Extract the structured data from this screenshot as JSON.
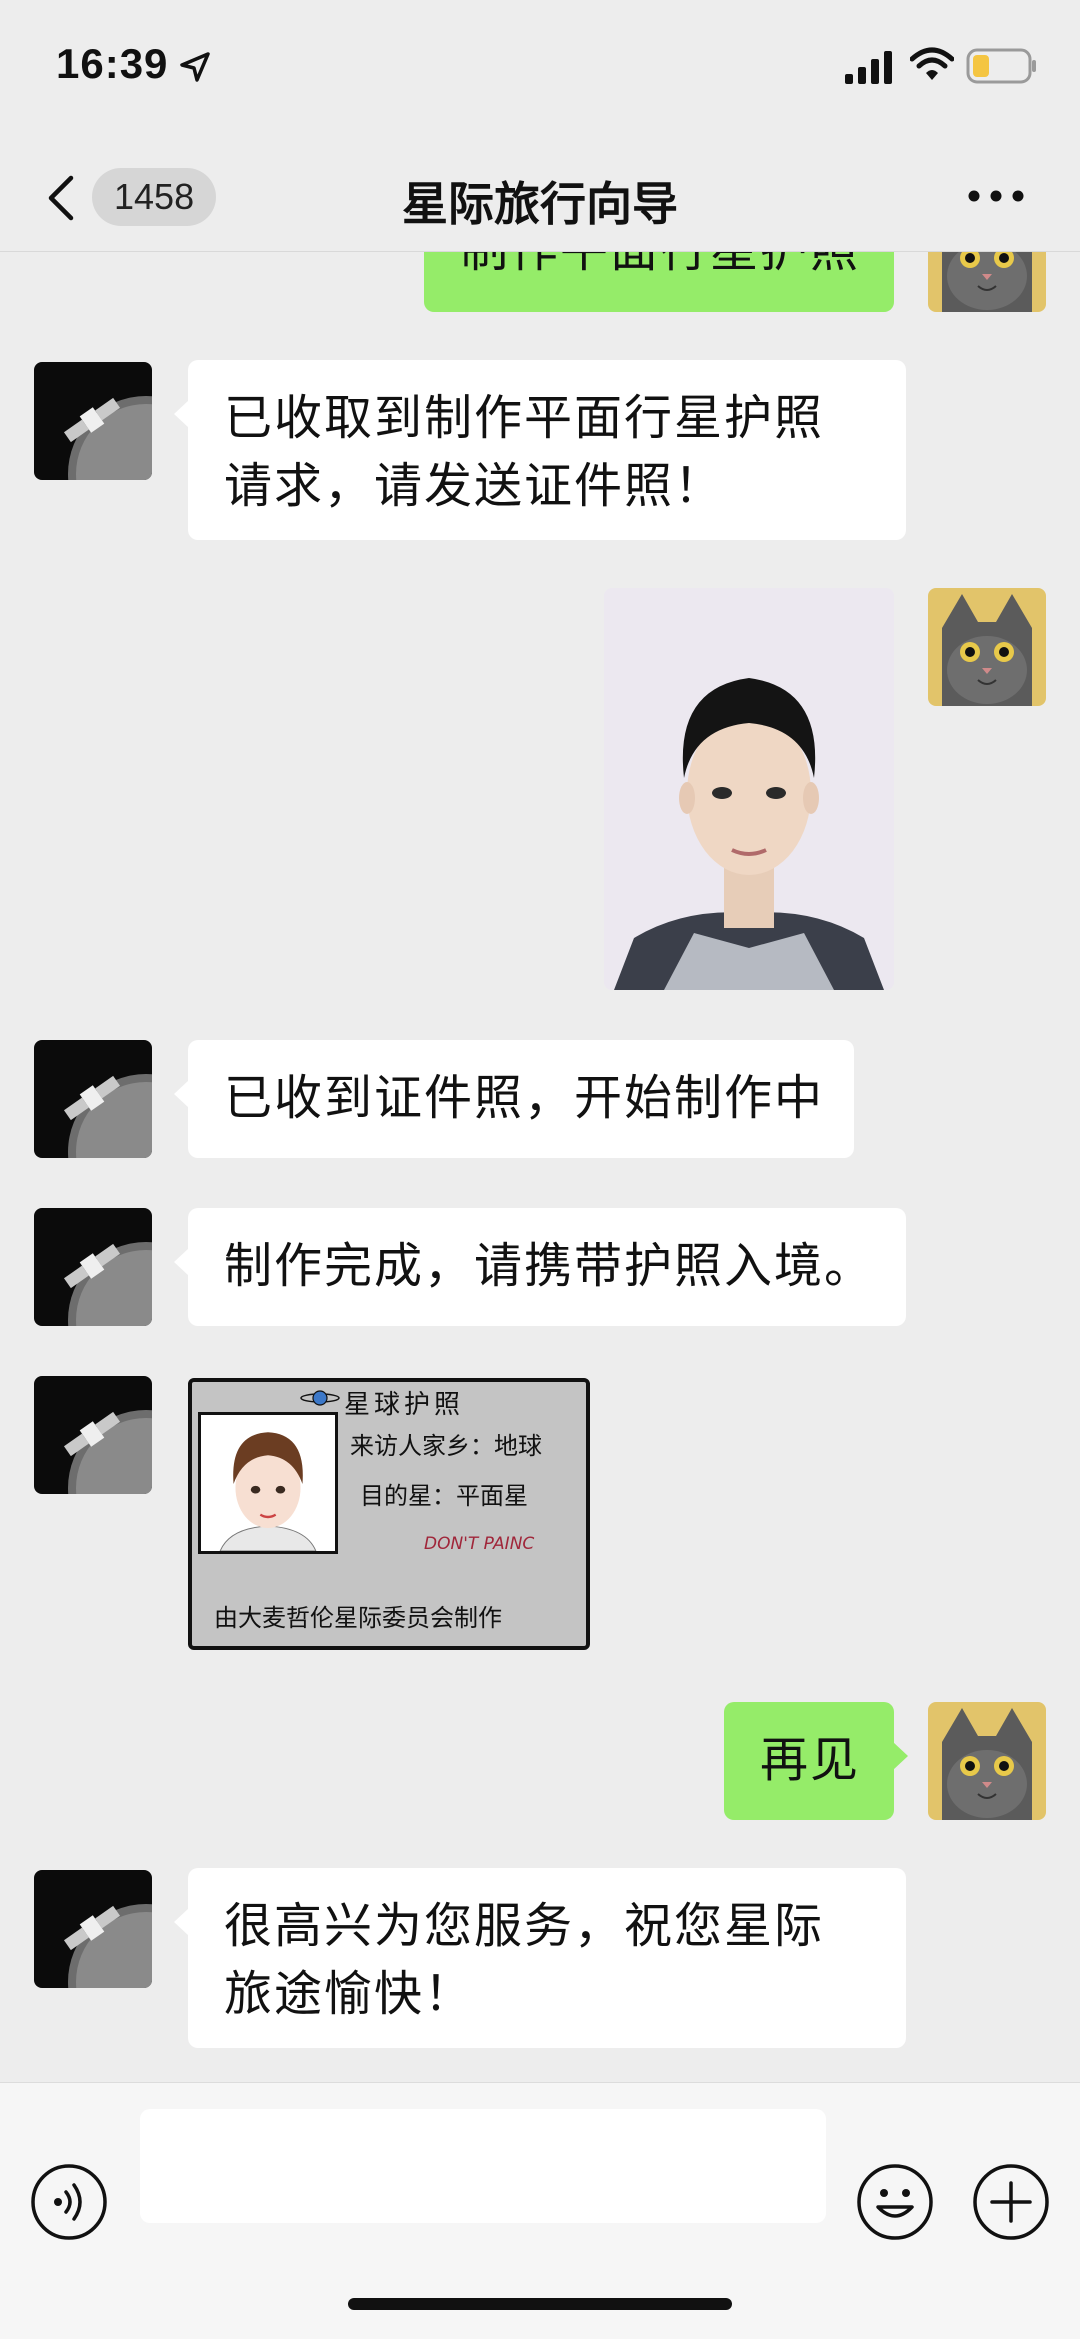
{
  "status_bar": {
    "time": "16:39",
    "icons": [
      "location-arrow-icon",
      "signal-bars-icon",
      "wifi-icon",
      "battery-low-icon"
    ]
  },
  "nav": {
    "unread_count": "1458",
    "title": "星际旅行向导",
    "back_icon": "chevron-left-icon",
    "more_icon": "ellipsis-icon"
  },
  "messages": [
    {
      "side": "out",
      "type": "text",
      "text": "制作平面行星护照"
    },
    {
      "side": "in",
      "type": "text",
      "text": "已收取到制作平面行星护照请求，请发送证件照！"
    },
    {
      "side": "out",
      "type": "image",
      "image": "id-photo"
    },
    {
      "side": "in",
      "type": "text",
      "text": "已收到证件照，开始制作中"
    },
    {
      "side": "in",
      "type": "text",
      "text": "制作完成，请携带护照入境。"
    },
    {
      "side": "in",
      "type": "image",
      "image": "planet-passport"
    },
    {
      "side": "out",
      "type": "text",
      "text": "再见"
    },
    {
      "side": "in",
      "type": "text",
      "text": "很高兴为您服务，祝您星际旅途愉快！"
    }
  ],
  "passport_card": {
    "title": "星球护照",
    "origin": "来访人家乡：地球",
    "destination": "目的星：平面星",
    "slogan": "DON'T PAINC",
    "footer": "由大麦哲伦星际委员会制作"
  },
  "input_bar": {
    "placeholder": "",
    "icons": [
      "voice-icon",
      "emoji-icon",
      "plus-icon"
    ]
  },
  "colors": {
    "background": "#ededed",
    "outgoing_bubble": "#95ec69",
    "incoming_bubble": "#ffffff"
  }
}
